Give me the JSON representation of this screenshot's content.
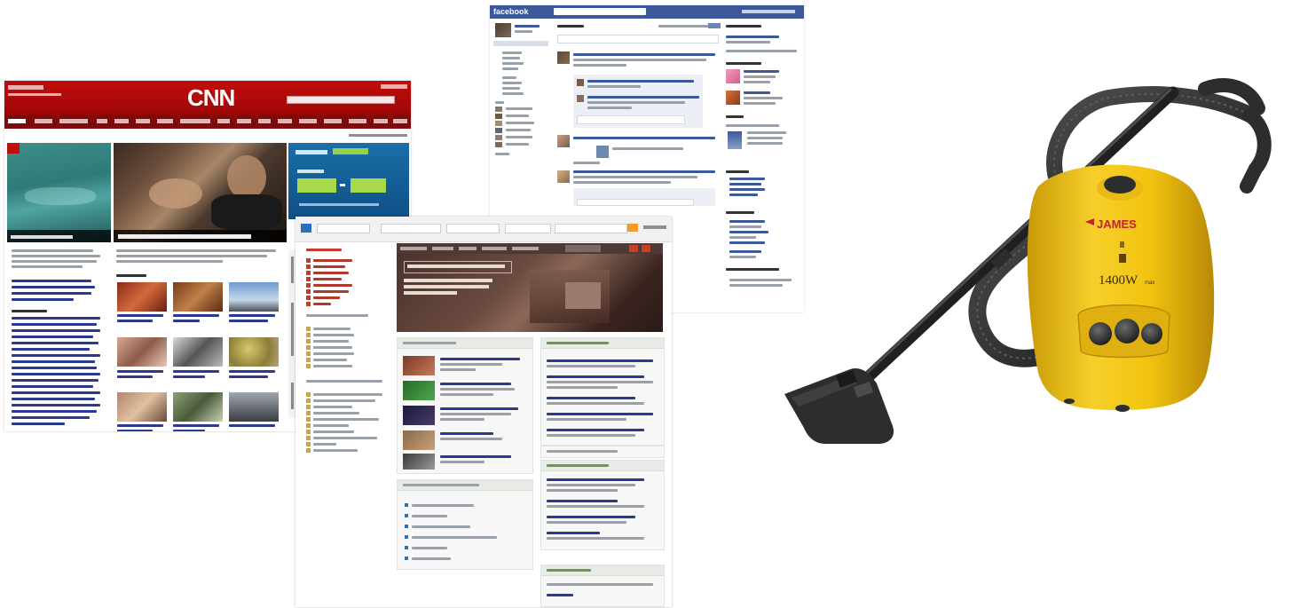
{
  "cnn": {
    "logo": "CNN"
  },
  "facebook": {
    "brand": "facebook"
  },
  "vacuum": {
    "brand": "JAMES",
    "power": "1400W",
    "power_suffix": "max"
  },
  "colors": {
    "cnn_red": "#c20d0d",
    "facebook_blue": "#3b5998",
    "vacuum_yellow": "#f2c410",
    "vacuum_gray": "#2b2d2f"
  }
}
